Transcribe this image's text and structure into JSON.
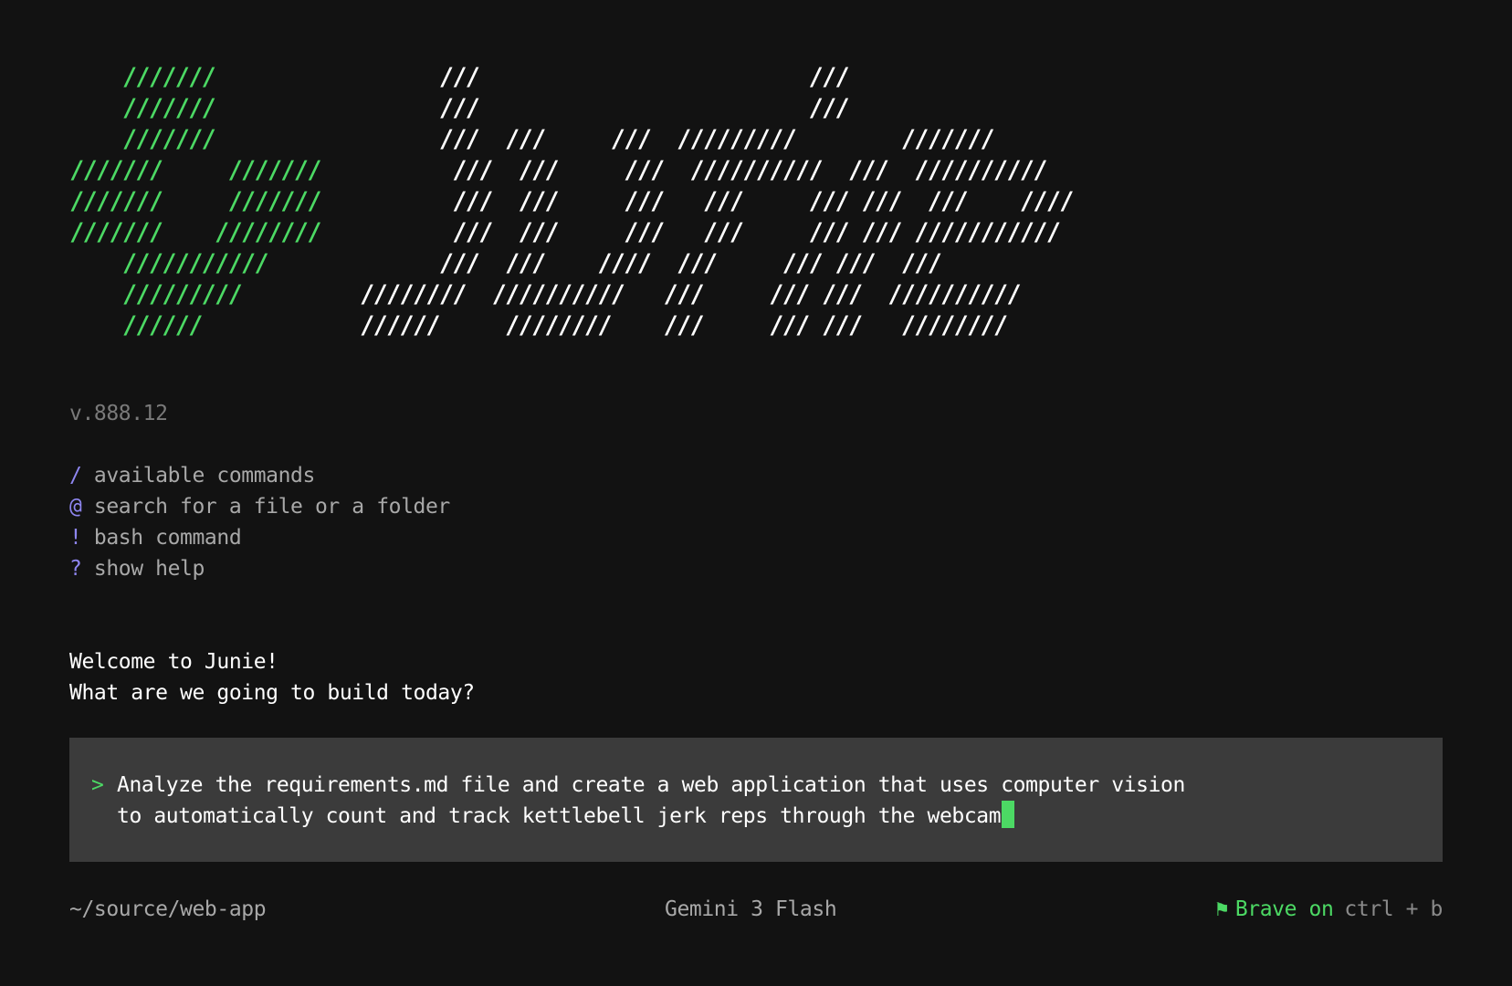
{
  "logo": {
    "lines": [
      {
        "mark": "    ///////",
        "word": "                 ///                         ///"
      },
      {
        "mark": "    ///////",
        "word": "                 ///                         ///"
      },
      {
        "mark": "    ///////",
        "word": "                 ///  ///     ///  /////////        ///////"
      },
      {
        "mark": "///////     ///////",
        "word": "          ///  ///     ///  //////////  ///  //////////"
      },
      {
        "mark": "///////     ///////",
        "word": "          ///  ///     ///   ///     /// ///  ///    ////"
      },
      {
        "mark": "///////    ////////",
        "word": "          ///  ///     ///   ///     /// /// ///////////"
      },
      {
        "mark": "    ///////////",
        "word": "             ///  ///    ////  ///     /// ///  ///"
      },
      {
        "mark": "    /////////",
        "word": "         ////////  //////////   ///     /// ///  //////////"
      },
      {
        "mark": "    //////",
        "word": "            //////     ////////    ///     /// ///   ////////"
      }
    ]
  },
  "version": "v.888.12",
  "hints": [
    {
      "symbol": "/",
      "text": "available commands"
    },
    {
      "symbol": "@",
      "text": "search for a file or a folder"
    },
    {
      "symbol": "!",
      "text": "bash command"
    },
    {
      "symbol": "?",
      "text": "show help"
    }
  ],
  "welcome": {
    "line1": "Welcome to Junie!",
    "line2": "What are we going to build today?"
  },
  "prompt": {
    "caret": ">",
    "line1": "Analyze the requirements.md file and create a web application that uses computer vision",
    "line2": "to automatically count and track kettlebell jerk reps through the webcam"
  },
  "status": {
    "cwd": "~/source/web-app",
    "model": "Gemini 3 Flash",
    "brave_icon": "flag-icon",
    "brave_glyph": "⚑",
    "brave_label": "Brave on",
    "brave_shortcut": "ctrl + b"
  },
  "colors": {
    "background": "#121212",
    "accent_green": "#4cd964",
    "hint_purple": "#8e86f0",
    "input_background": "#3b3b3b"
  }
}
